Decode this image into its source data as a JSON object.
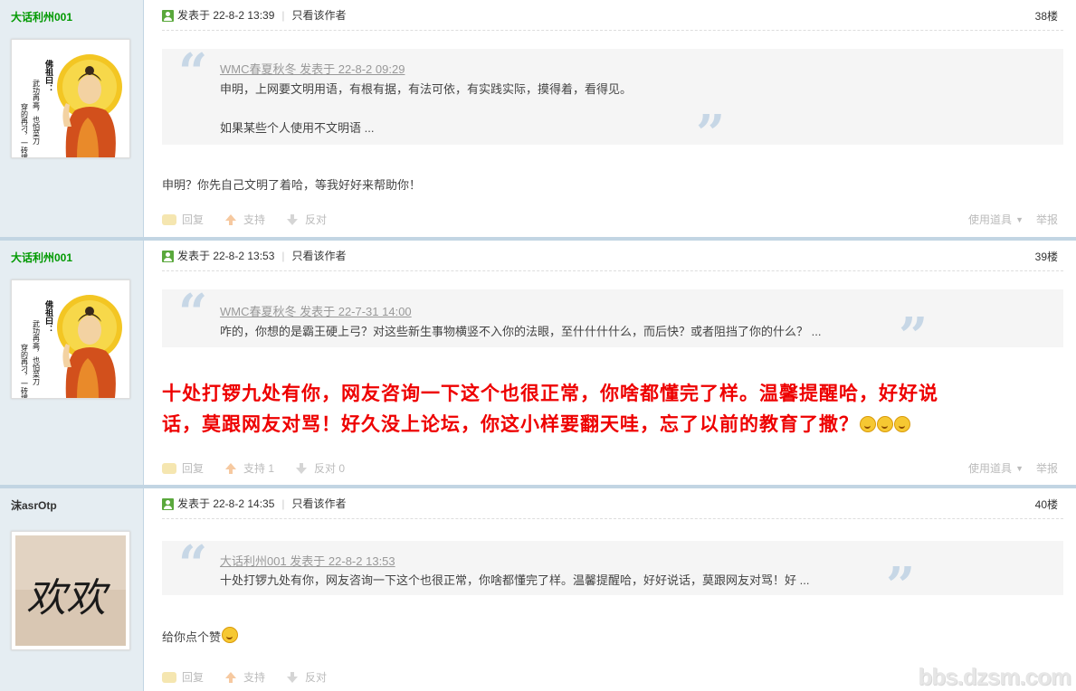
{
  "posts": [
    {
      "username": "大话利州001",
      "posted": "发表于 22-8-2 13:39",
      "author_only": "只看该作者",
      "floor": "38楼",
      "quote": {
        "head": "WMC春夏秋冬 发表于 22-8-2 09:29",
        "lines": [
          "申明，上网要文明用语，有根有据，有法可依，有实践实际，摸得着，看得见。",
          "如果某些个人使用不文明语 ..."
        ]
      },
      "body": "申明？你先自己文明了着哈，等我好好来帮助你！",
      "actions": {
        "reply": "回复",
        "support": "支持",
        "oppose": "反对"
      },
      "tools": "使用道具",
      "report": "举报"
    },
    {
      "username": "大话利州001",
      "posted": "发表于 22-8-2 13:53",
      "author_only": "只看该作者",
      "floor": "39楼",
      "quote": {
        "head": "WMC春夏秋冬 发表于 22-7-31 14:00",
        "lines": [
          "咋的，你想的是霸王硬上弓？对这些新生事物横竖不入你的法眼，至什什什什么，而后快？或者阻挡了你的什么？ ..."
        ]
      },
      "body_line1": "十处打锣九处有你，网友咨询一下这个也很正常，你啥都懂完了样。温馨提醒哈，好好说",
      "body_line2": "话，莫跟网友对骂！好久没上论坛，你这小样要翻天哇，忘了以前的教育了撒？",
      "actions": {
        "reply": "回复",
        "support": "支持 1",
        "oppose": "反对 0"
      },
      "tools": "使用道具",
      "report": "举报"
    },
    {
      "username": "沫asrOtp",
      "posted": "发表于 22-8-2 14:35",
      "author_only": "只看该作者",
      "floor": "40楼",
      "quote": {
        "head": "大话利州001 发表于 22-8-2 13:53",
        "lines": [
          "十处打锣九处有你，网友咨询一下这个也很正常，你啥都懂完了样。温馨提醒哈，好好说话，莫跟网友对骂！好 ..."
        ]
      },
      "body": "给你点个赞",
      "actions": {
        "reply": "回复",
        "support": "支持",
        "oppose": "反对"
      }
    }
  ],
  "avatar_text": {
    "title": "佛祖曰：",
    "col1": "武功再高，也怕菜刀",
    "col2": "穿的再刁，一砖撂"
  },
  "avatar2_text": "欢欢",
  "watermark": "bbs.dzsm.com",
  "colors": {
    "username_green": "#009900",
    "big_text_red": "#ee0000",
    "separator": "#c2d5e3",
    "sidebar_bg": "#e5edf2"
  }
}
